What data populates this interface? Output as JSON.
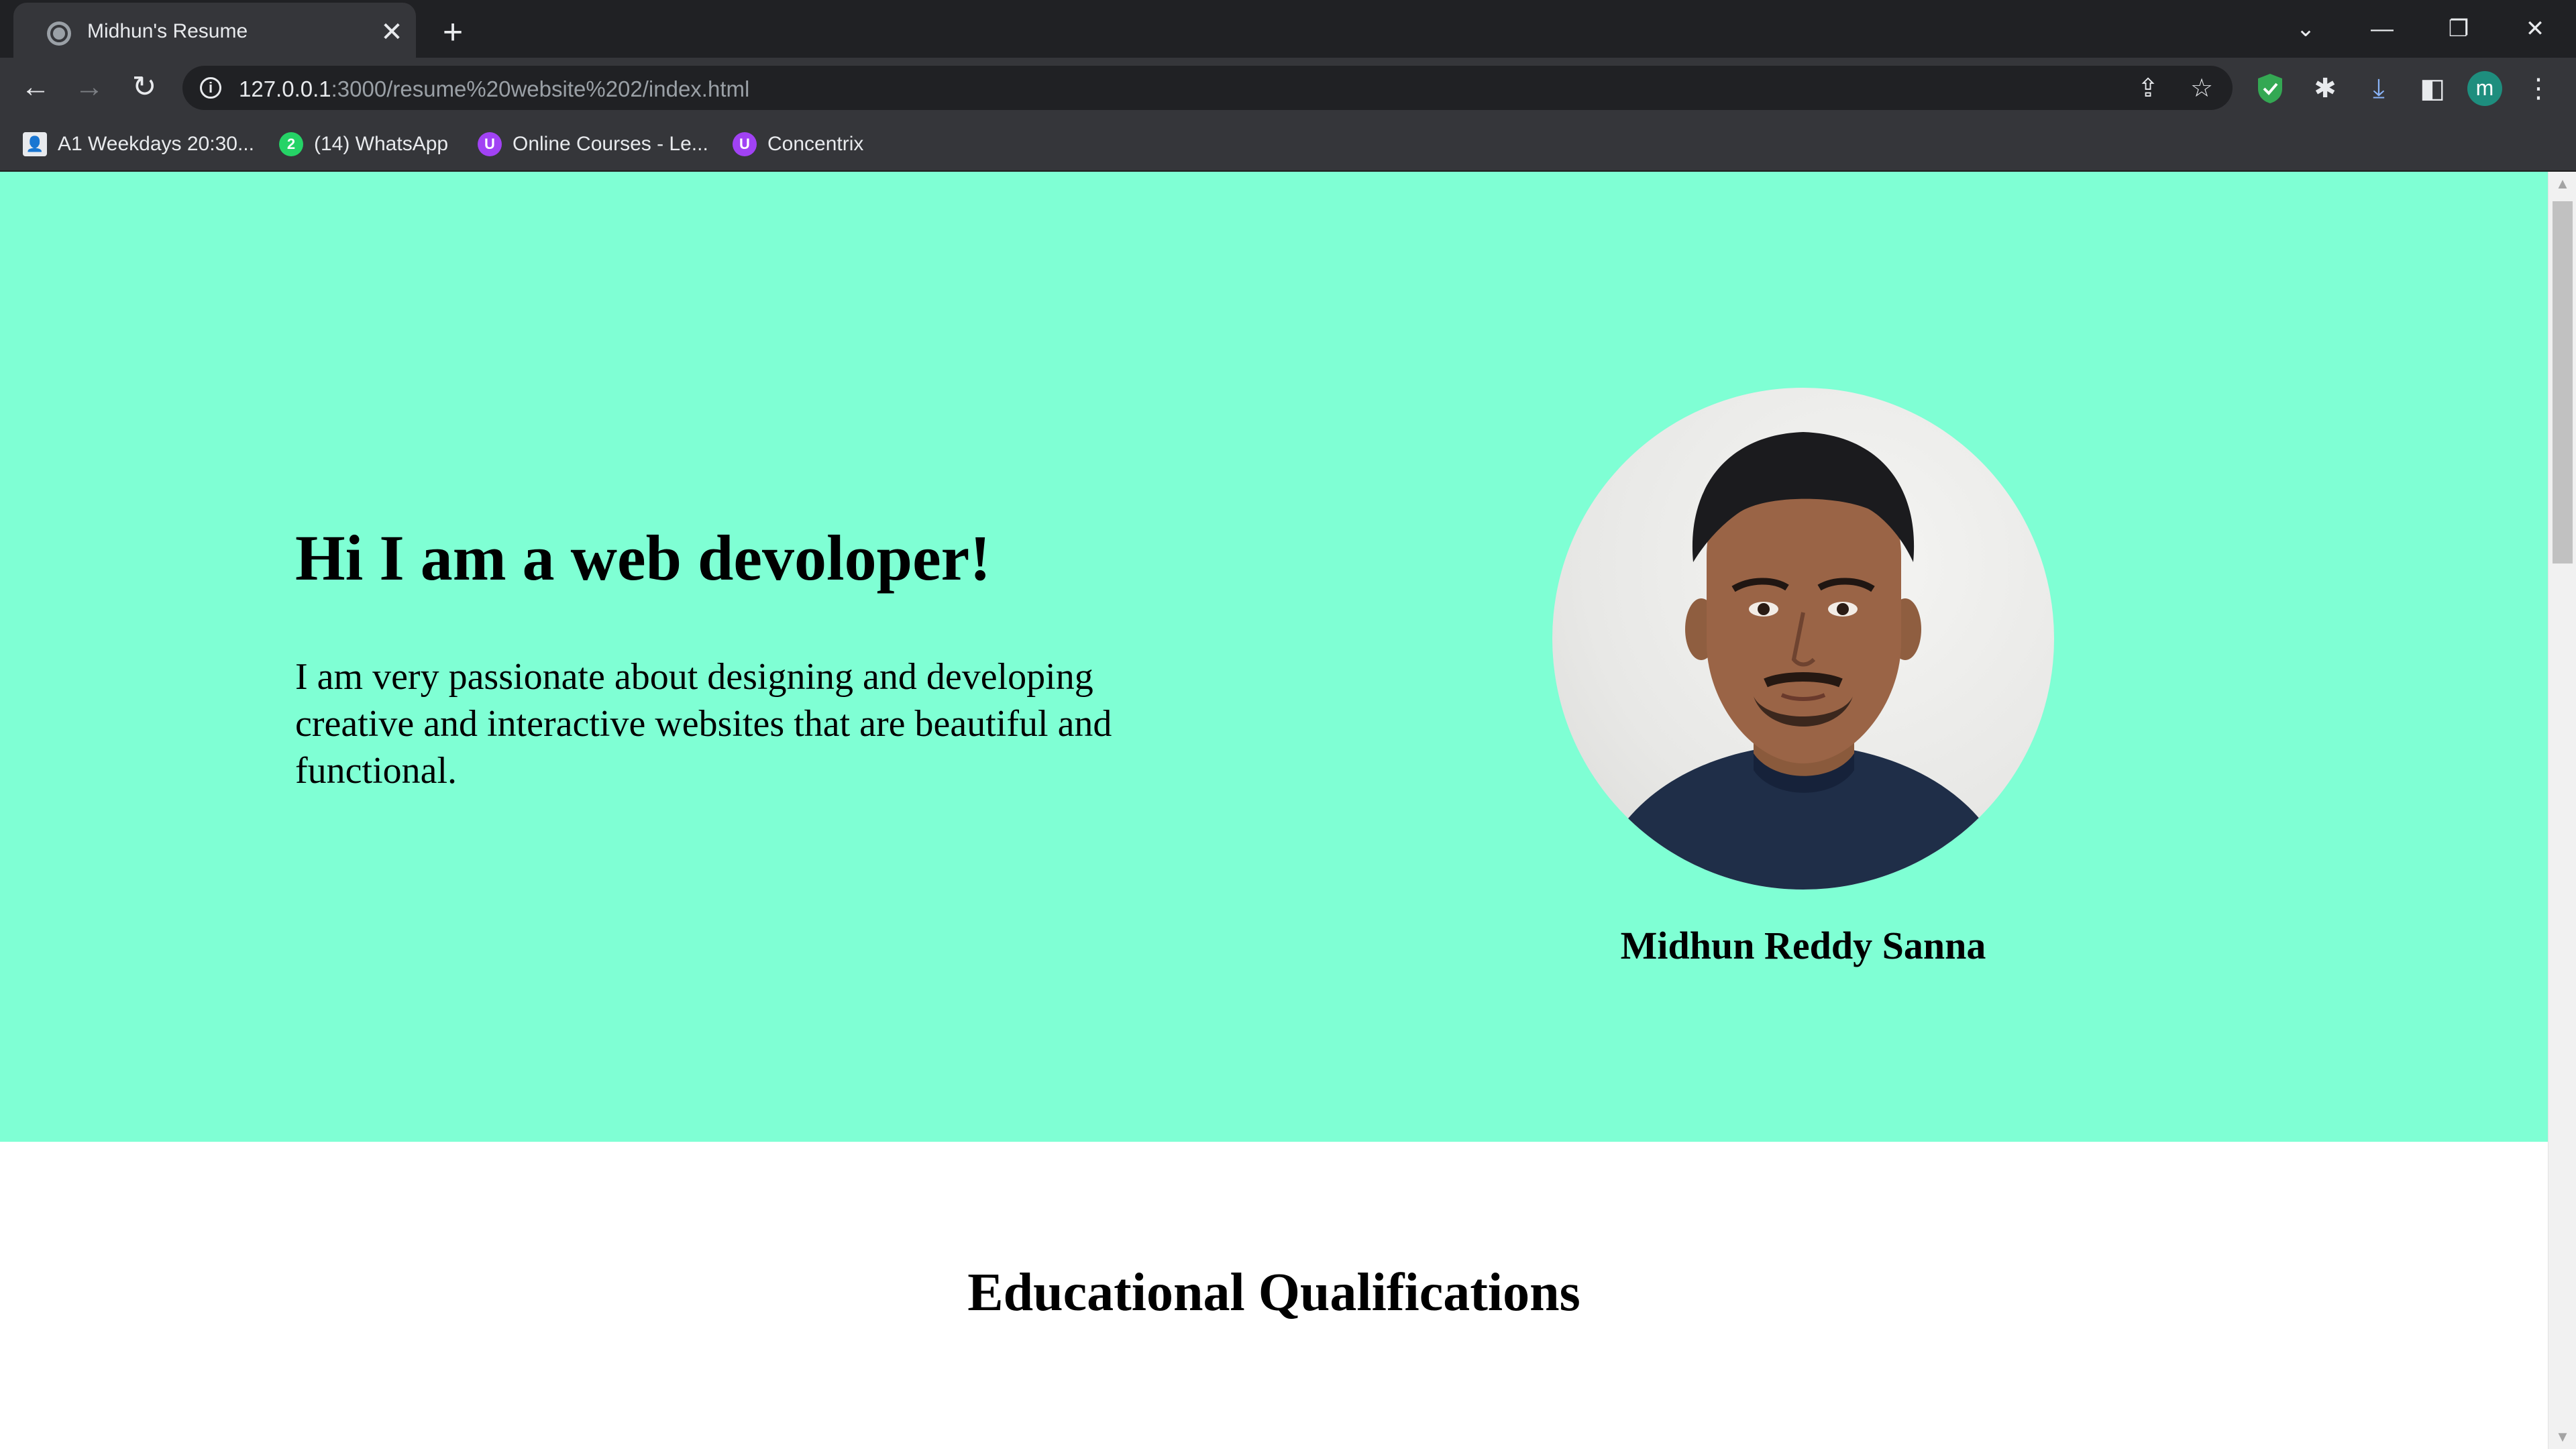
{
  "browser": {
    "tab": {
      "title": "Midhun's Resume",
      "close_glyph": "✕"
    },
    "new_tab_glyph": "+",
    "window_controls": {
      "tab_search_glyph": "⌄",
      "minimize_glyph": "—",
      "restore_glyph": "❐",
      "close_glyph": "✕"
    },
    "nav": {
      "back_glyph": "←",
      "forward_glyph": "→",
      "reload_glyph": "↻"
    },
    "omnibox": {
      "info_glyph": "i",
      "url_host": "127.0.0.1",
      "url_rest": ":3000/resume%20website%202/index.html",
      "share_glyph": "⇪",
      "bookmark_glyph": "☆"
    },
    "toolbar_icons": {
      "extensions_glyph": "✱",
      "download_glyph": "⤓",
      "side_panel_glyph": "◧",
      "avatar_letter": "m",
      "menu_glyph": "⋮"
    },
    "bookmarks": [
      {
        "label": "A1 Weekdays 20:30...",
        "icon": "contact-icon",
        "glyph": "👤"
      },
      {
        "label": "(14) WhatsApp",
        "icon": "whatsapp-icon",
        "glyph": "2"
      },
      {
        "label": "Online Courses - Le...",
        "icon": "udemy-icon",
        "glyph": "U"
      },
      {
        "label": "Concentrix",
        "icon": "udemy-icon",
        "glyph": "U"
      }
    ]
  },
  "page": {
    "hero": {
      "title": "Hi I am a web devoloper!",
      "description": "I am very passionate about designing and developing creative and interactive websites that are beautiful and functional.",
      "name": "Midhun Reddy Sanna",
      "background_color": "#7fffd4"
    },
    "education": {
      "title": "Educational Qualifications"
    }
  },
  "scrollbar": {
    "up_glyph": "▲",
    "down_glyph": "▼"
  },
  "colors": {
    "chrome_dark": "#202124",
    "chrome_toolbar": "#35363a",
    "hero_bg": "#7fffd4",
    "avatar": "#1e8e7e",
    "shield": "#34a853"
  }
}
